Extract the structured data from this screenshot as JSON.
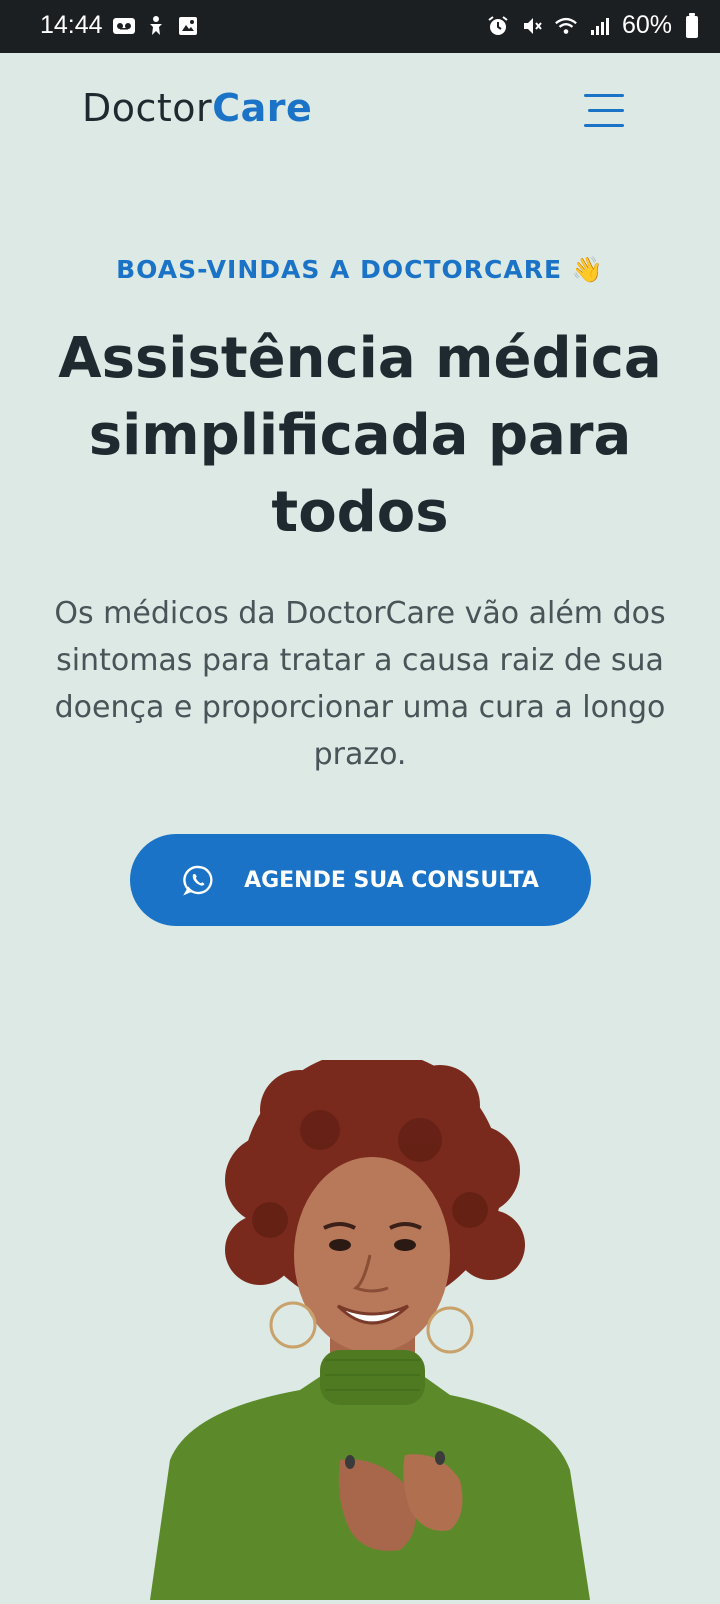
{
  "status_bar": {
    "time": "14:44",
    "battery": "60%",
    "icons": [
      "voicemail-icon",
      "accessibility-icon",
      "image-icon",
      "alarm-icon",
      "mute-icon",
      "wifi-icon",
      "signal-icon",
      "battery-icon"
    ]
  },
  "header": {
    "logo_part1": "Doctor",
    "logo_part2": "Care",
    "menu_icon": "hamburger-menu-icon"
  },
  "hero": {
    "eyebrow": "BOAS-VINDAS A DOCTORCARE 👋",
    "title": "Assistência médica simplificada para todos",
    "description": "Os médicos da DoctorCare vão além dos sintomas para tratar a causa raiz de sua doença e proporcionar uma cura a longo prazo.",
    "cta_label": "AGENDE SUA CONSULTA",
    "cta_icon": "whatsapp-icon"
  },
  "colors": {
    "background": "#dce9e4",
    "accent": "#1a73c6",
    "text": "#1f2a30"
  }
}
